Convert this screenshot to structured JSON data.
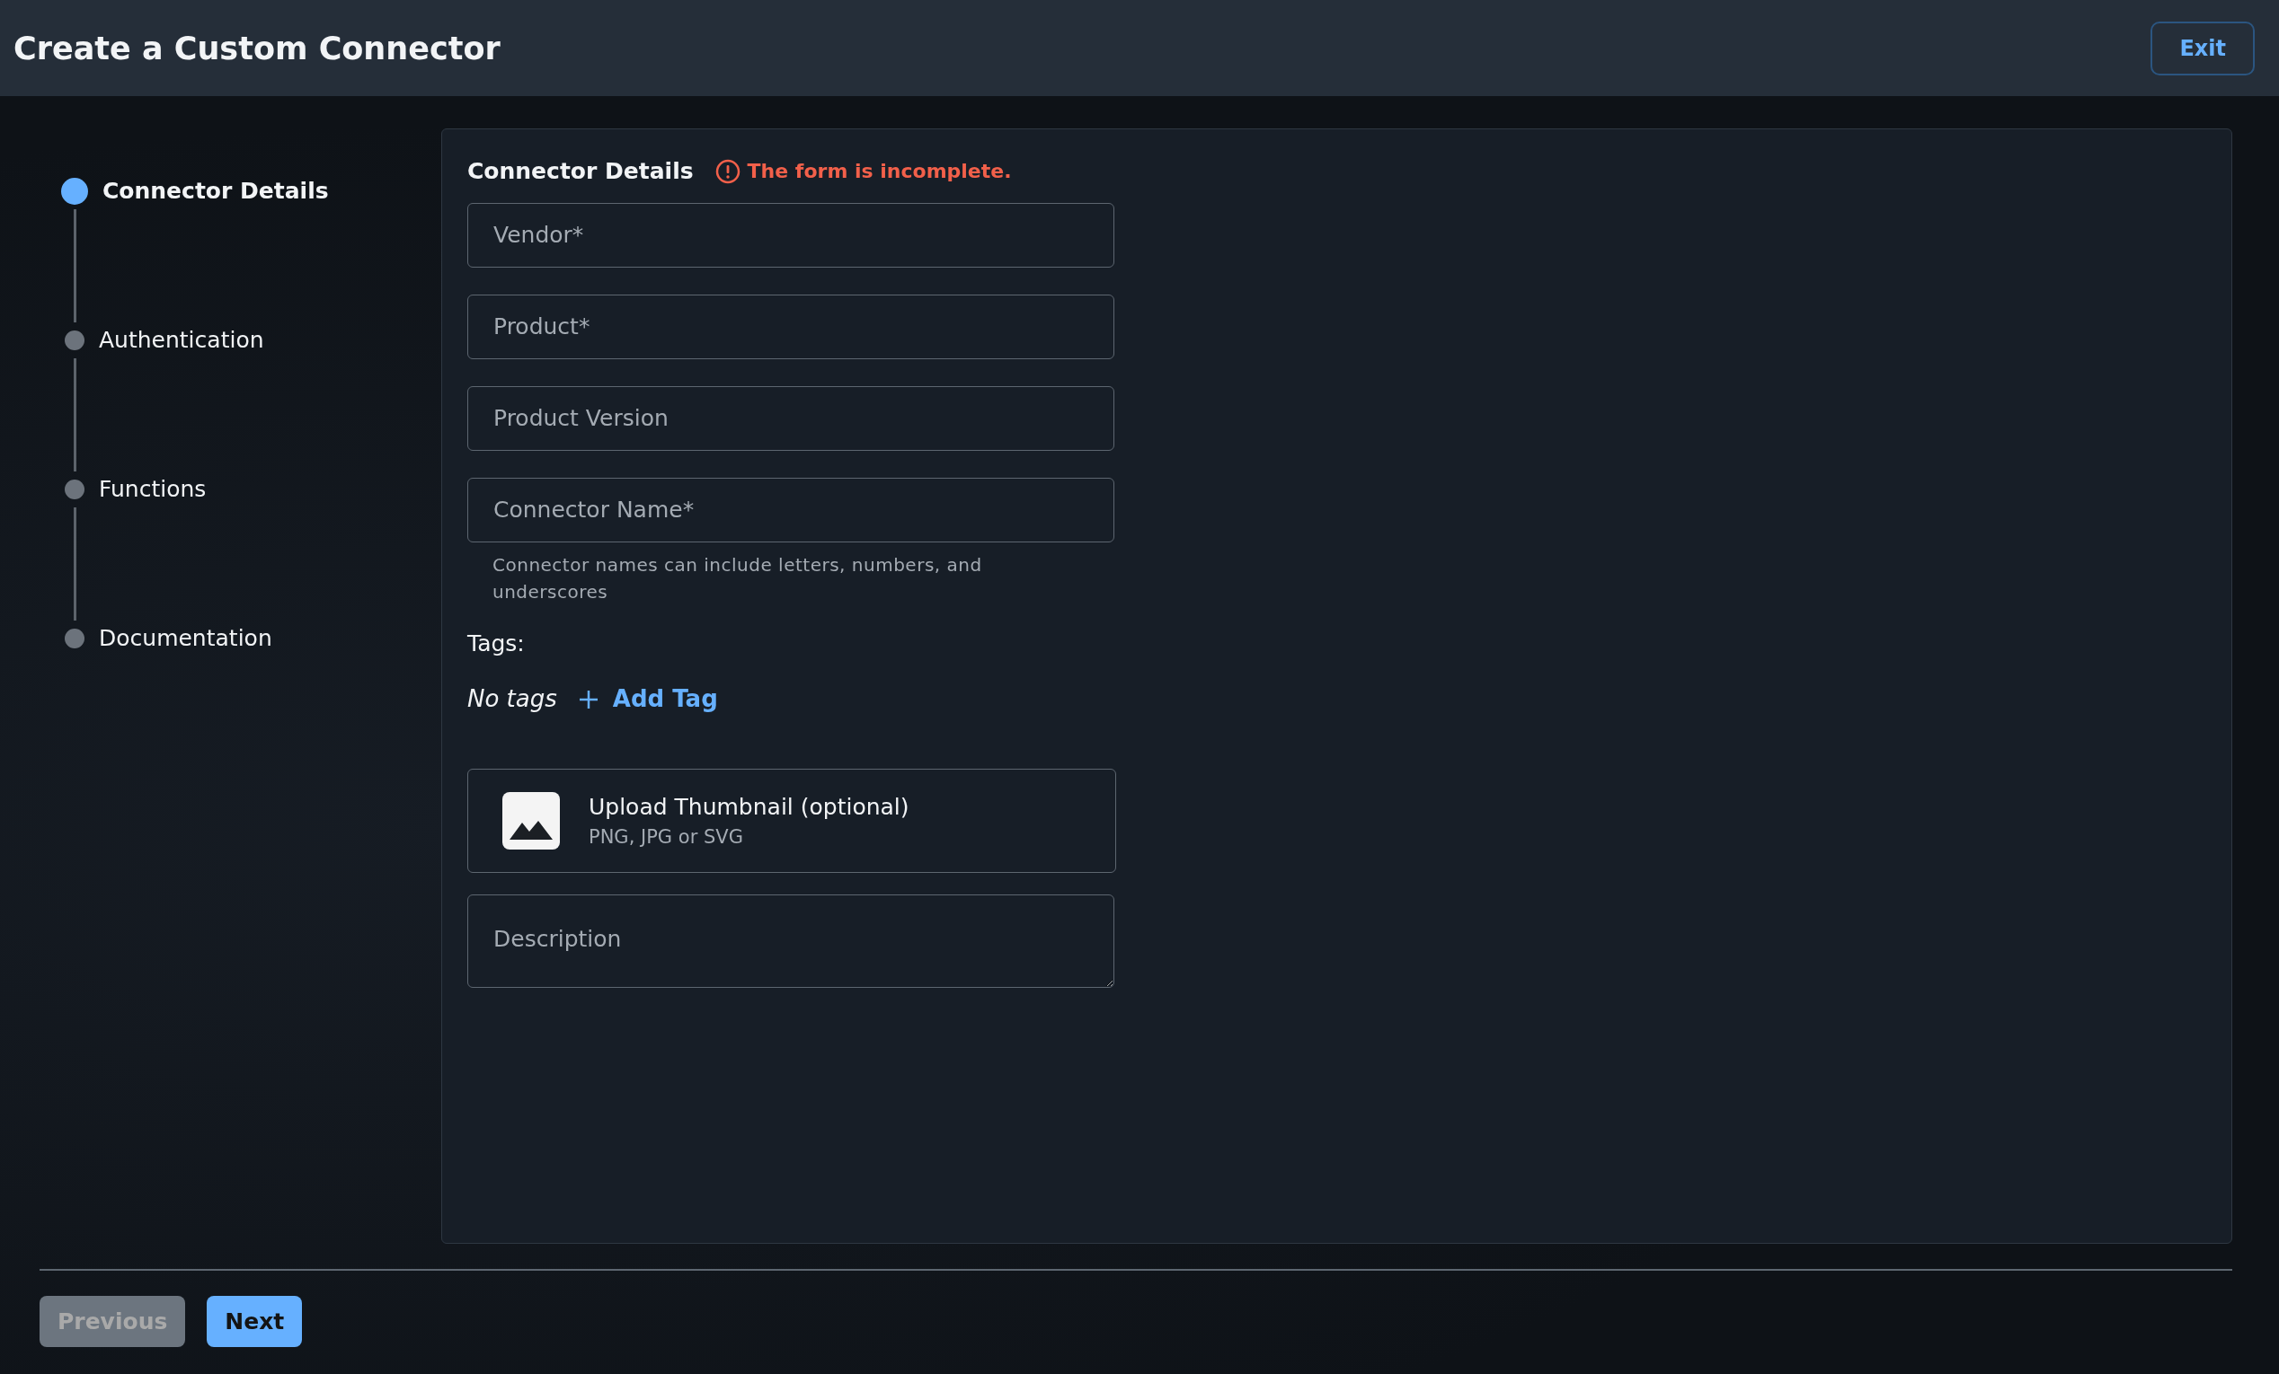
{
  "header": {
    "title": "Create a Custom Connector",
    "exit_button": "Exit"
  },
  "steps": [
    {
      "label": "Connector Details",
      "selected": true
    },
    {
      "label": "Authentication",
      "selected": false
    },
    {
      "label": "Functions",
      "selected": false
    },
    {
      "label": "Documentation",
      "selected": false
    }
  ],
  "form": {
    "title": "Connector Details",
    "status": "The form is incomplete.",
    "fields": [
      {
        "placeholder": "Vendor*"
      },
      {
        "placeholder": "Product*"
      },
      {
        "placeholder": "Product Version"
      },
      {
        "placeholder": "Connector Name*",
        "help": "Connector names can include letters, numbers, and underscores"
      }
    ],
    "tags": {
      "label": "Tags:",
      "empty_text": "No tags",
      "add_button": "Add Tag"
    },
    "thumbnail": {
      "title": "Upload Thumbnail (optional)",
      "subtitle": "PNG, JPG or SVG"
    },
    "description": {
      "placeholder": "Description"
    }
  },
  "footer": {
    "buttons": [
      {
        "label": "Previous",
        "disabled": true
      },
      {
        "label": "Next",
        "disabled": false
      }
    ]
  }
}
